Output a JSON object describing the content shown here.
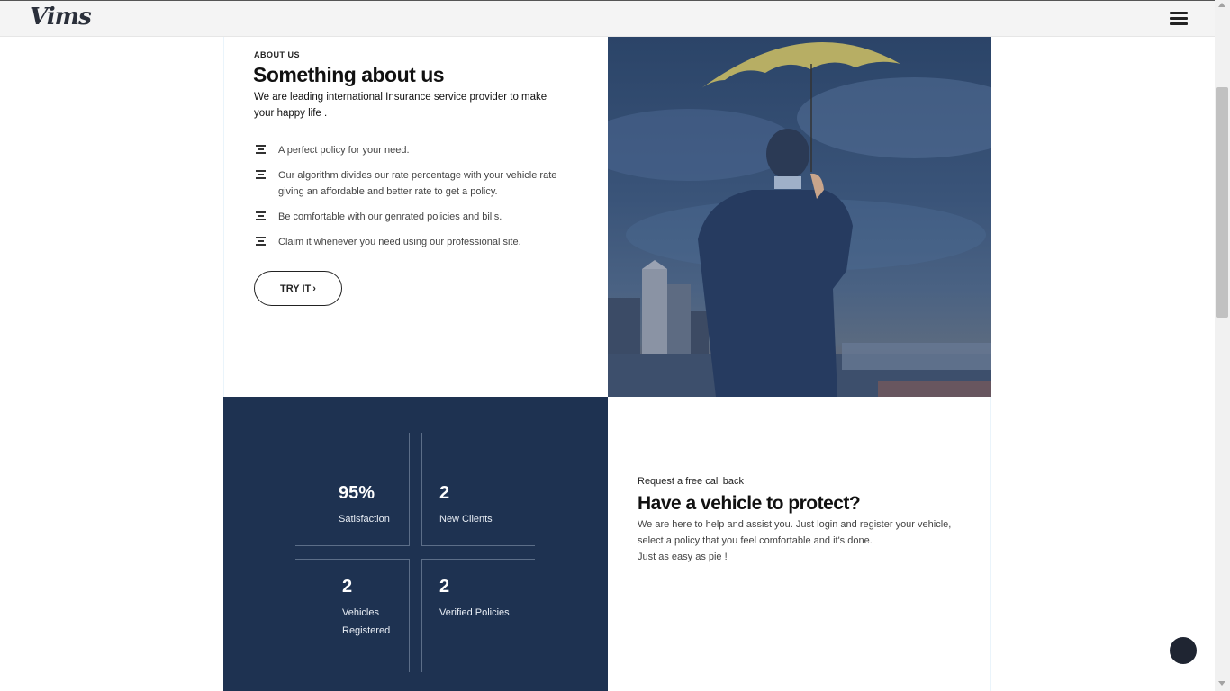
{
  "header": {
    "logo_text": "Vims",
    "menu_icon": "hamburger-menu-icon"
  },
  "about": {
    "eyebrow": "ABOUT US",
    "title": "Something about us",
    "lead": "We are leading international Insurance service provider to make your happy life .",
    "features": [
      "A perfect policy for your need.",
      "Our algorithm divides our rate percentage with your vehicle rate giving an affordable and better rate to get a policy.",
      "Be comfortable with our genrated policies and bills.",
      "Claim it whenever you need using our professional site."
    ],
    "feature_icon": "align-center-icon",
    "button_label": "TRY IT",
    "button_icon": "chevron-right-icon"
  },
  "stats": [
    {
      "value": "95%",
      "label": "Satisfaction"
    },
    {
      "value": "2",
      "label": "New Clients"
    },
    {
      "value": "2",
      "label": "Vehicles Registered"
    },
    {
      "value": "2",
      "label": "Verified Policies"
    }
  ],
  "cta": {
    "eyebrow": "Request a free call back",
    "title": "Have a vehicle to protect?",
    "line1": "We are here to help and assist you. Just login and register your vehicle, select a policy that you feel comfortable and it's done.",
    "line2": "Just as easy as pie !"
  },
  "colors": {
    "stats_bg": "#1e3251",
    "photo_tint": "#2b4468",
    "chat_button": "#1f2532"
  }
}
